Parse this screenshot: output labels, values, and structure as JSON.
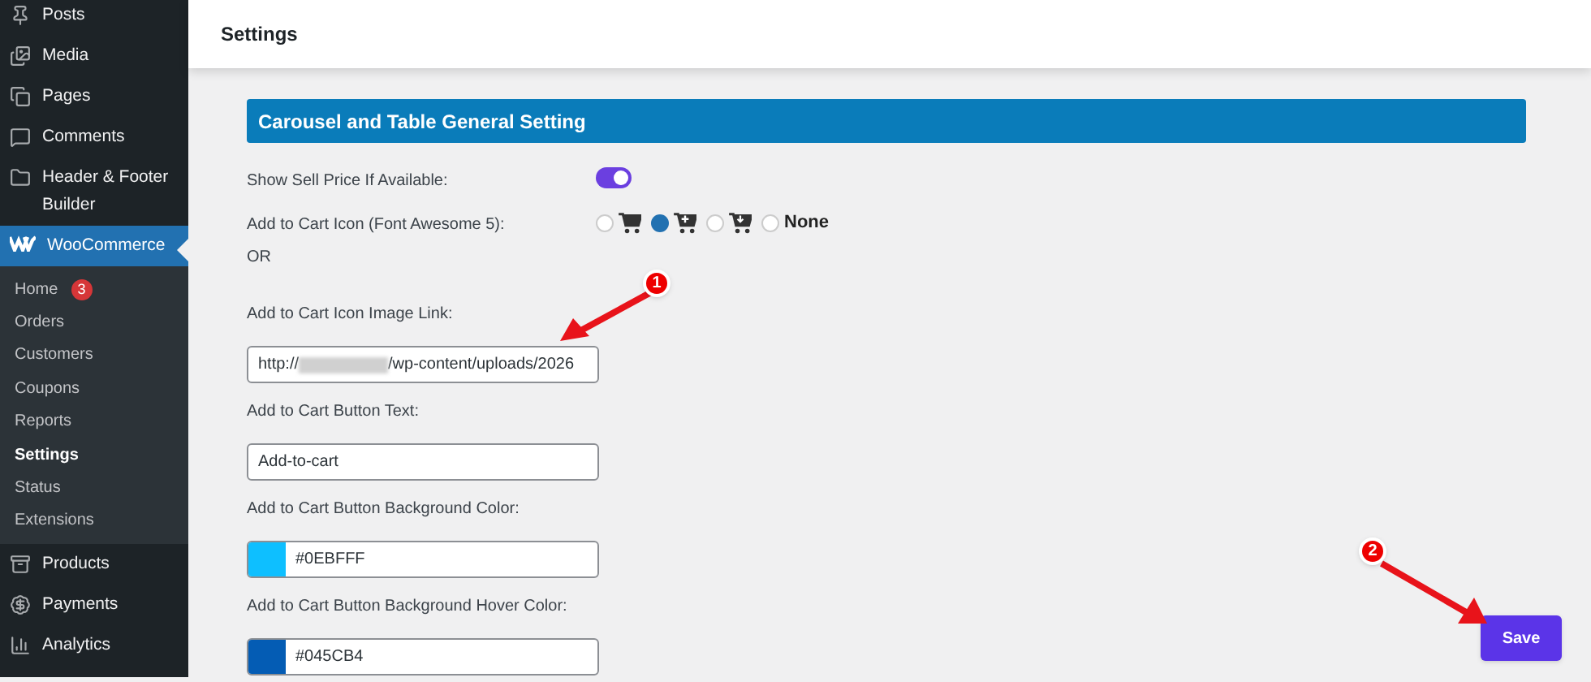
{
  "sidebar": {
    "items": [
      {
        "label": "Posts",
        "selected": false
      },
      {
        "label": "Media",
        "selected": false
      },
      {
        "label": "Pages",
        "selected": false
      },
      {
        "label": "Comments",
        "selected": false
      },
      {
        "label": "Header & Footer Builder",
        "selected": false
      },
      {
        "label": "WooCommerce",
        "selected": true,
        "children": [
          {
            "label": "Home",
            "badge": "3",
            "selected": false
          },
          {
            "label": "Orders",
            "selected": false
          },
          {
            "label": "Customers",
            "selected": false
          },
          {
            "label": "Coupons",
            "selected": false
          },
          {
            "label": "Reports",
            "selected": false
          },
          {
            "label": "Settings",
            "selected": true
          },
          {
            "label": "Status",
            "selected": false
          },
          {
            "label": "Extensions",
            "selected": false
          }
        ]
      },
      {
        "label": "Products",
        "selected": false
      },
      {
        "label": "Payments",
        "selected": false
      },
      {
        "label": "Analytics",
        "selected": false
      }
    ]
  },
  "header": {
    "title": "Settings"
  },
  "panel": {
    "title": "Carousel and Table General Setting",
    "fields": [
      {
        "kind": "toggle",
        "label": "Show Sell Price If Available:",
        "on": true
      },
      {
        "kind": "radios",
        "label": "Add to Cart Icon (Font Awesome 5):",
        "options": [
          {
            "kind": "cart",
            "selected": false
          },
          {
            "kind": "cart-plus",
            "selected": true
          },
          {
            "kind": "cart-down",
            "selected": false
          },
          {
            "kind": "text",
            "text": "None",
            "selected": false
          }
        ]
      },
      {
        "kind": "note",
        "label": "OR"
      },
      {
        "kind": "url",
        "label": "Add to Cart Icon Image Link:",
        "prefix": "http://",
        "value": "/wp-content/uploads/2026"
      },
      {
        "kind": "text",
        "label": "Add to Cart Button Text:",
        "value": "Add-to-cart"
      },
      {
        "kind": "color",
        "label": "Add to Cart Button Background Color:",
        "value": "#0EBFFF",
        "color": "#0ebfff"
      },
      {
        "kind": "color",
        "label": "Add to Cart Button Background Hover Color:",
        "value": "#045CB4",
        "color": "#045cb4"
      }
    ]
  },
  "save_button": {
    "label": "Save"
  },
  "callouts": [
    {
      "number": "1"
    },
    {
      "number": "2"
    }
  ]
}
